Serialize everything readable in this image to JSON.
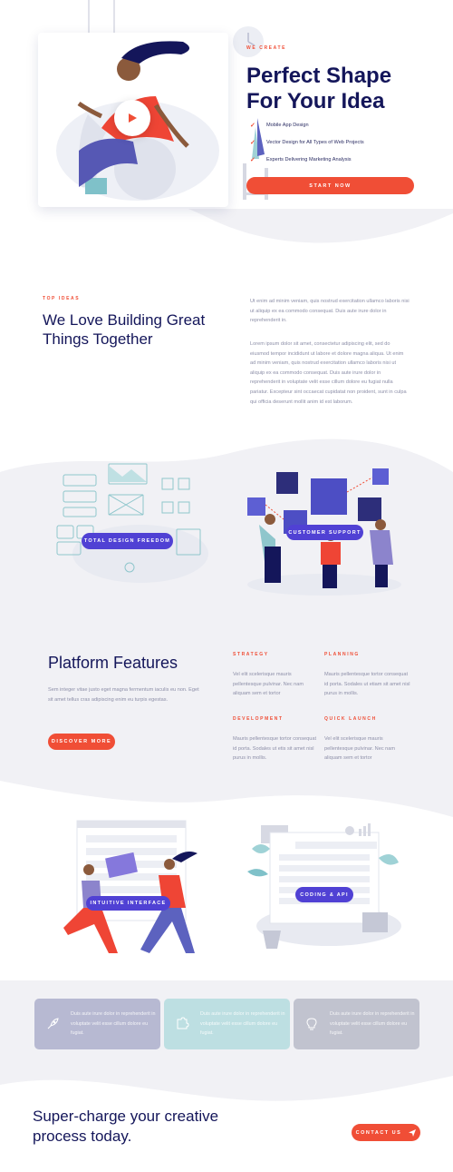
{
  "hero": {
    "eyebrow": "We Create",
    "title_line1": "Perfect Shape",
    "title_line2": "For Your Idea",
    "checklist": [
      "Mobile App Design",
      "Vector Design for All Types of Web Projects",
      "Experts Delivering Marketing Analysis"
    ],
    "cta": "Start Now",
    "play_icon": "play-icon",
    "check_icon": "check-icon"
  },
  "about": {
    "eyebrow": "Top Ideas",
    "title_line1": "We Love Building Great",
    "title_line2": "Things Together",
    "paragraph1": "Ut enim ad minim veniam, quis nostrud exercitation ullamco laboris nisi ut aliquip ex ea commodo consequat. Duis aute irure dolor in reprehenderit in.",
    "paragraph2": "Lorem ipsum dolor sit amet, consectetur adipiscing elit, sed do eiusmod tempor incididunt ut labore et dolore magna aliqua. Ut enim ad minim veniam, quis nostrud exercitation ullamco laboris nisi ut aliquip ex ea commodo consequat. Duis aute irure dolor in reprehenderit in voluptate velit esse cillum dolore eu fugiat nulla pariatur. Excepteur sint occaecat cupidatat non proident, sunt in culpa qui officia deserunt mollit anim id est laborum."
  },
  "illustrations": {
    "design_label": "Total Design Freedom",
    "support_label": "Customer Support",
    "interface_label": "Intuitive Interface",
    "coding_label": "Coding & API"
  },
  "features": {
    "title": "Platform Features",
    "description": "Sem integer vitae justo eget magna fermentum iaculis eu non. Eget sit amet tellus cras adipiscing enim eu turpis egestas.",
    "cta": "Discover More",
    "items": [
      {
        "heading": "Strategy",
        "text": "Vel elit scelerisque mauris pellentesque pulvinar. Nec nam aliquam sem et tortor"
      },
      {
        "heading": "Planning",
        "text": "Mauris pellentesque tortor consequat id porta. Sodales ut etiam sit amet nisl purus in mollis."
      },
      {
        "heading": "Development",
        "text": "Mauris pellentesque tortor consequat id porta. Sodales ut etis sit amet nisl purus in mollis."
      },
      {
        "heading": "Quick Launch",
        "text": "Vel elit scelerisque mauris pellentesque pulvinar. Nec nam aliquam sem et tortor"
      }
    ]
  },
  "cards": [
    {
      "icon": "rocket-icon",
      "text": "Duis aute irure dolor in reprehenderit in voluptate velit esse cillum dolore eu fugiat.",
      "color": "#b7b9d2"
    },
    {
      "icon": "puzzle-icon",
      "text": "Duis aute irure dolor in reprehenderit in voluptate velit esse cillum dolore eu fugiat.",
      "color": "#bddfe2"
    },
    {
      "icon": "lightbulb-icon",
      "text": "Duis aute irure dolor in reprehenderit in voluptate velit esse cillum dolore eu fugiat.",
      "color": "#c1c3cf"
    }
  ],
  "cta": {
    "title_line1": "Super-charge your creative",
    "title_line2": "process today.",
    "button": "Contact Us",
    "send_icon": "paper-plane-icon"
  },
  "colors": {
    "accent": "#f04e36",
    "navy": "#14165a",
    "purple": "#5041d4"
  }
}
